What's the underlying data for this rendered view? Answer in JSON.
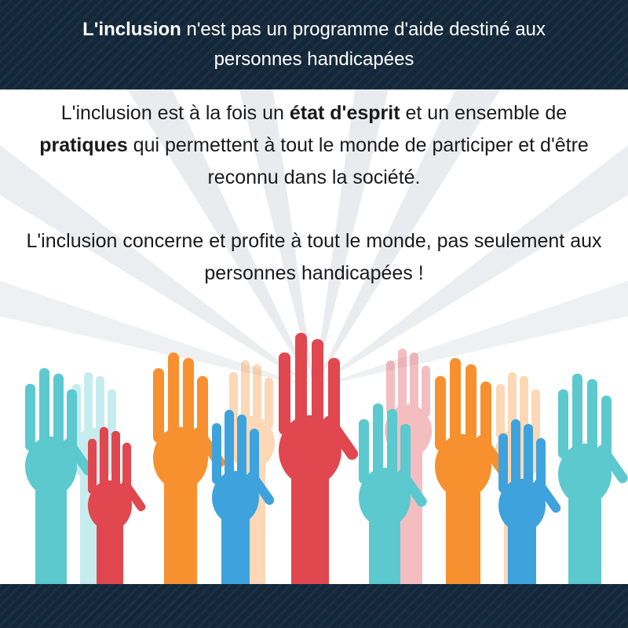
{
  "header": {
    "title_bold": "L'inclusion",
    "title_rest": " n'est pas un programme d'aide destiné aux personnes handicapées"
  },
  "body": {
    "para1": {
      "part1": "L'inclusion est à la fois un ",
      "bold1": "état d'esprit",
      "part2": " et un ensemble de ",
      "bold2": "pratiques",
      "part3": " qui permettent à tout le monde de participer et d'être reconnu dans la société."
    },
    "para2": "L'inclusion concerne et profite à tout le monde, pas seulement aux personnes handicapées !"
  },
  "colors": {
    "band": "#13273a",
    "teal": "#5cc9cf",
    "red": "#e0474f",
    "orange": "#f7902f",
    "blue": "#3ea3dd",
    "rays": "#e4e6ea"
  },
  "illustration": {
    "hands": [
      "teal",
      "red",
      "orange",
      "blue",
      "red",
      "teal",
      "orange",
      "blue",
      "teal"
    ]
  }
}
